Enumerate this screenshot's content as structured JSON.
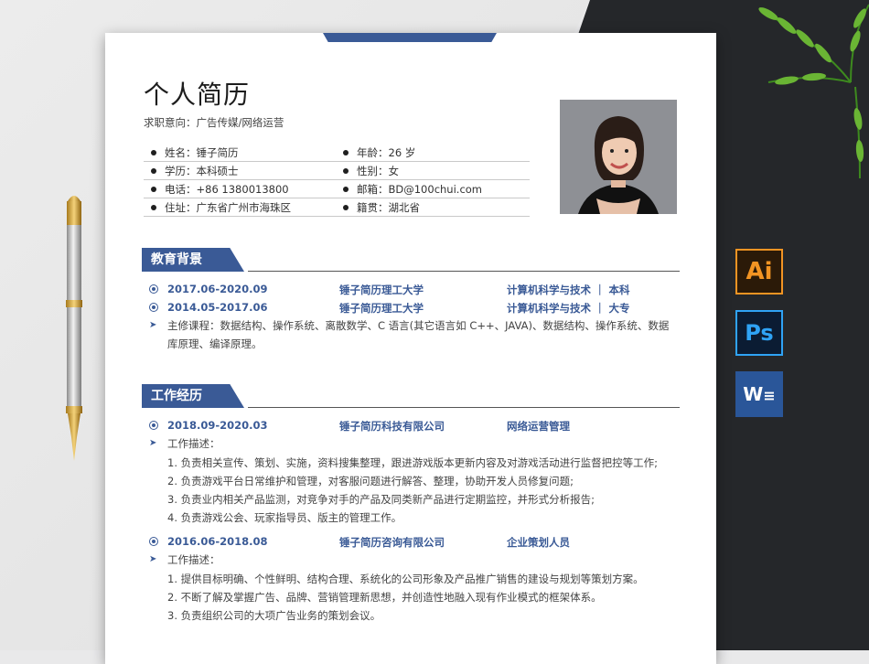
{
  "resume": {
    "title": "个人简历",
    "intent": "求职意向：广告传媒/网络运营",
    "info": [
      {
        "left": "姓名：锤子简历",
        "right": "年龄：26 岁"
      },
      {
        "left": "学历：本科硕士",
        "right": "性别：女"
      },
      {
        "left": "电话：+86 1380013800",
        "right": "邮箱：BD@100chui.com"
      },
      {
        "left": "住址：广东省广州市海珠区",
        "right": "籍贯：湖北省"
      }
    ],
    "education": {
      "heading": "教育背景",
      "entries": [
        {
          "date": "2017.06-2020.09",
          "school": "锤子简历理工大学",
          "major": "计算机科学与技术 ｜ 本科"
        },
        {
          "date": "2014.05-2017.06",
          "school": "锤子简历理工大学",
          "major": "计算机科学与技术 ｜ 大专"
        }
      ],
      "courses_line1": "主修课程：数据结构、操作系统、离散数学、C 语言(其它语言如 C++、JAVA)、数据结构、操作系统、数据",
      "courses_line2": "库原理、编译原理。"
    },
    "work": {
      "heading": "工作经历",
      "jobs": [
        {
          "date": "2018.09-2020.03",
          "company": "锤子简历科技有限公司",
          "role": "网络运营管理",
          "desc_label": "工作描述：",
          "items": [
            "1. 负责相关宣传、策划、实施，资料搜集整理，跟进游戏版本更新内容及对游戏活动进行监督把控等工作;",
            "2. 负责游戏平台日常维护和管理，对客服问题进行解答、整理，协助开发人员修复问题;",
            "3. 负责业内相关产品监测，对竞争对手的产品及同类新产品进行定期监控，并形式分析报告;",
            "4. 负责游戏公会、玩家指导员、版主的管理工作。"
          ]
        },
        {
          "date": "2016.06-2018.08",
          "company": "锤子简历咨询有限公司",
          "role": "企业策划人员",
          "desc_label": "工作描述：",
          "items": [
            "1. 提供目标明确、个性鲜明、结构合理、系统化的公司形象及产品推广销售的建设与规划等策划方案。",
            "2. 不断了解及掌握广告、品牌、营销管理新思想，并创造性地融入现有作业模式的框架体系。",
            "3. 负责组织公司的大项广告业务的策划会议。"
          ]
        }
      ]
    }
  },
  "apps": {
    "ai_label": "Ai",
    "ps_label": "Ps",
    "word_label": "W"
  },
  "colors": {
    "accent": "#3a5a96",
    "ai_orange": "#f29423",
    "ps_blue": "#2fa3f5",
    "word_blue": "#2a5699"
  },
  "icons": [
    "photo-portrait",
    "pen-icon",
    "plant-decoration",
    "ai-app-icon",
    "ps-app-icon",
    "word-app-icon"
  ]
}
